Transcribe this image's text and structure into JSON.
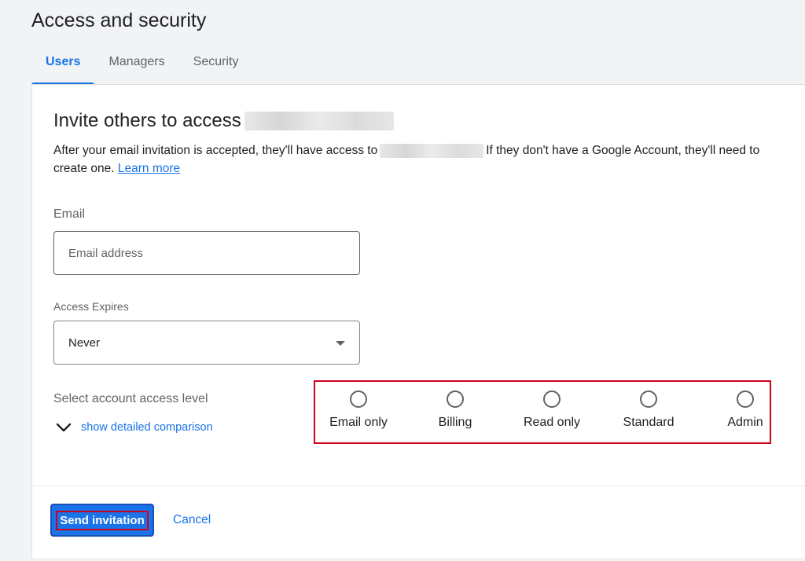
{
  "page": {
    "title": "Access and security"
  },
  "tabs": [
    {
      "label": "Users",
      "active": true
    },
    {
      "label": "Managers",
      "active": false
    },
    {
      "label": "Security",
      "active": false
    }
  ],
  "invite": {
    "heading": "Invite others to access",
    "description_part1": "After your email invitation is accepted, they'll have access to",
    "description_part2": "If they don't have a Google Account, they'll need to create one.",
    "learn_more": "Learn more"
  },
  "email": {
    "label": "Email",
    "placeholder": "Email address"
  },
  "expires": {
    "label": "Access Expires",
    "value": "Never"
  },
  "access_level": {
    "label": "Select account access level",
    "comparison_link": "show detailed comparison",
    "options": [
      "Email only",
      "Billing",
      "Read only",
      "Standard",
      "Admin"
    ]
  },
  "actions": {
    "send": "Send invitation",
    "cancel": "Cancel"
  },
  "colors": {
    "accent": "#1a73e8",
    "highlight": "#d0021b"
  }
}
